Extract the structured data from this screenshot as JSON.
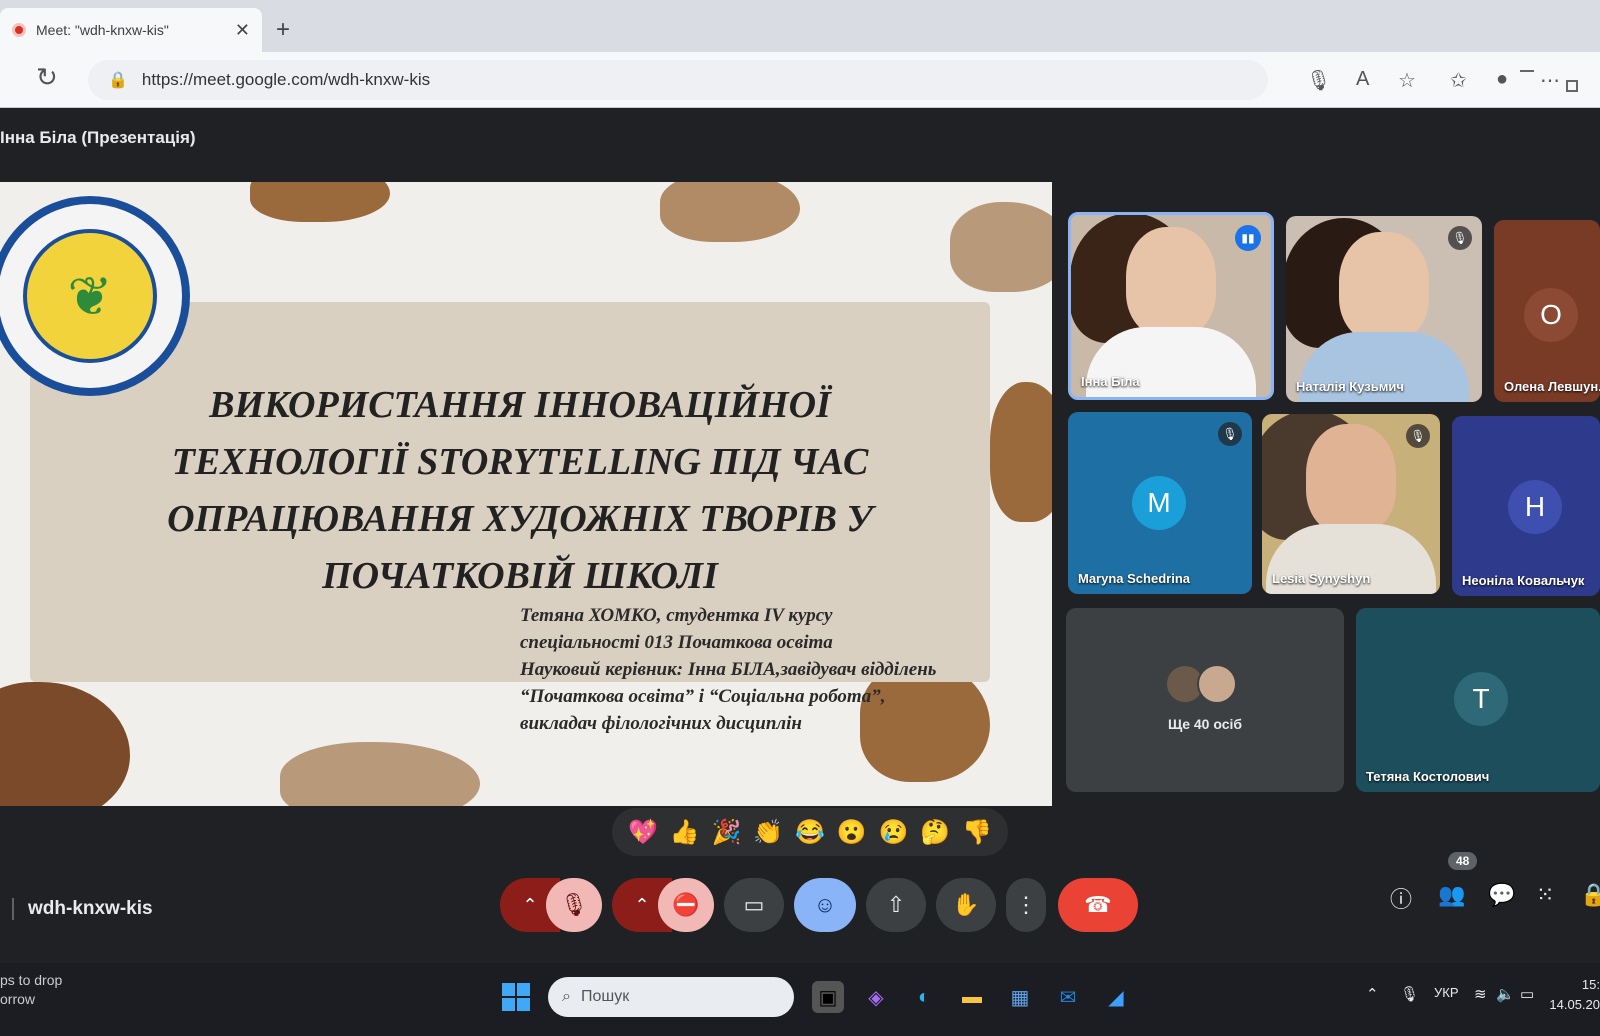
{
  "browser": {
    "tab_title": "Meet: \"wdh-knxw-kis\"",
    "url": "https://meet.google.com/wdh-knxw-kis"
  },
  "meet": {
    "presenter_label": "Інна Біла (Презентація)",
    "meeting_code": "wdh-knxw-kis",
    "people_count": "48",
    "slide": {
      "title": "ВИКОРИСТАННЯ ІННОВАЦІЙНОЇ ТЕХНОЛОГІЇ STORYTELLING ПІД ЧАС ОПРАЦЮВАННЯ ХУДОЖНІХ ТВОРІВ У ПОЧАТКОВІЙ ШКОЛІ",
      "author_lines": [
        "Тетяна ХОМКО, студентка IV курсу",
        "спеціальності 013 Початкова освіта",
        "Науковий керівник: Інна БІЛА,завідувач відділень",
        "“Початкова освіта” і “Соціальна робота”,",
        "викладач філологічних дисциплін"
      ]
    },
    "participants": [
      {
        "name": "Інна Біла",
        "initial": ""
      },
      {
        "name": "Наталія Кузьмич",
        "initial": ""
      },
      {
        "name": "Олена Левшун...",
        "initial": "О"
      },
      {
        "name": "Maryna Schedrina",
        "initial": "M"
      },
      {
        "name": "Lesia Synyshyn",
        "initial": ""
      },
      {
        "name": "Неоніла Ковальчук",
        "initial": "Н"
      },
      {
        "name": "Тетяна Костолович",
        "initial": "Т"
      }
    ],
    "more_people_label": "Ще 40 осіб",
    "reactions": [
      "💖",
      "👍",
      "🎉",
      "👏",
      "😂",
      "😮",
      "😢",
      "🤔",
      "👎"
    ]
  },
  "taskbar": {
    "search_placeholder": "Пошук",
    "widget_line1": "ps to drop",
    "widget_line2": "orrow",
    "language": "УКР",
    "time": "15:",
    "date": "14.05.20"
  },
  "colors": {
    "meet_bg": "#202124",
    "hangup": "#ea4335",
    "mic_off": "#f2b8b5",
    "active_blue": "#8ab4f8"
  }
}
